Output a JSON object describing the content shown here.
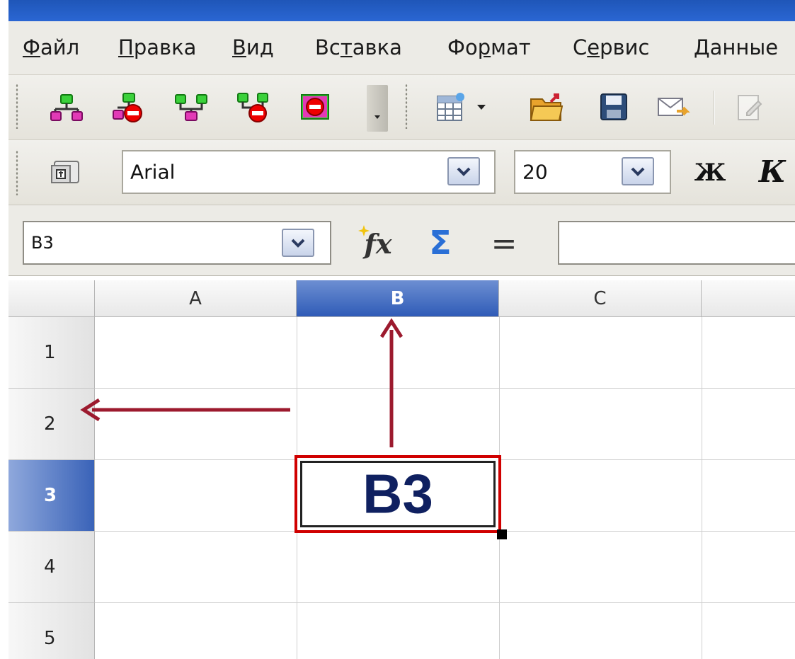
{
  "menu": {
    "file": {
      "acc": "Ф",
      "rest": "айл"
    },
    "edit": {
      "acc": "П",
      "rest": "равка"
    },
    "view": {
      "acc": "В",
      "rest": "ид"
    },
    "insert": {
      "pre": "Вс",
      "acc": "т",
      "rest": "авка"
    },
    "format": {
      "pre": "Фо",
      "acc": "р",
      "rest": "мат"
    },
    "tools": {
      "pre": "С",
      "acc": "е",
      "rest": "рвис"
    },
    "data": {
      "acc": "Д",
      "rest": "анные"
    }
  },
  "formatting": {
    "font_name": "Arial",
    "font_size": "20",
    "bold_label": "Ж",
    "italic_label": "К"
  },
  "formula_bar": {
    "name_box": "B3",
    "function_label": "fx",
    "sum_label": "Σ",
    "equals_label": "="
  },
  "grid": {
    "columns": [
      "A",
      "B",
      "C"
    ],
    "rows": [
      "1",
      "2",
      "3",
      "4",
      "5"
    ]
  },
  "annotation": {
    "cell_label": "B3",
    "arrow_color": "#9c1a2e",
    "highlight_color": "#d00000"
  },
  "colors": {
    "title_bar": "#2a66d3",
    "selection": "#3a63b8"
  }
}
